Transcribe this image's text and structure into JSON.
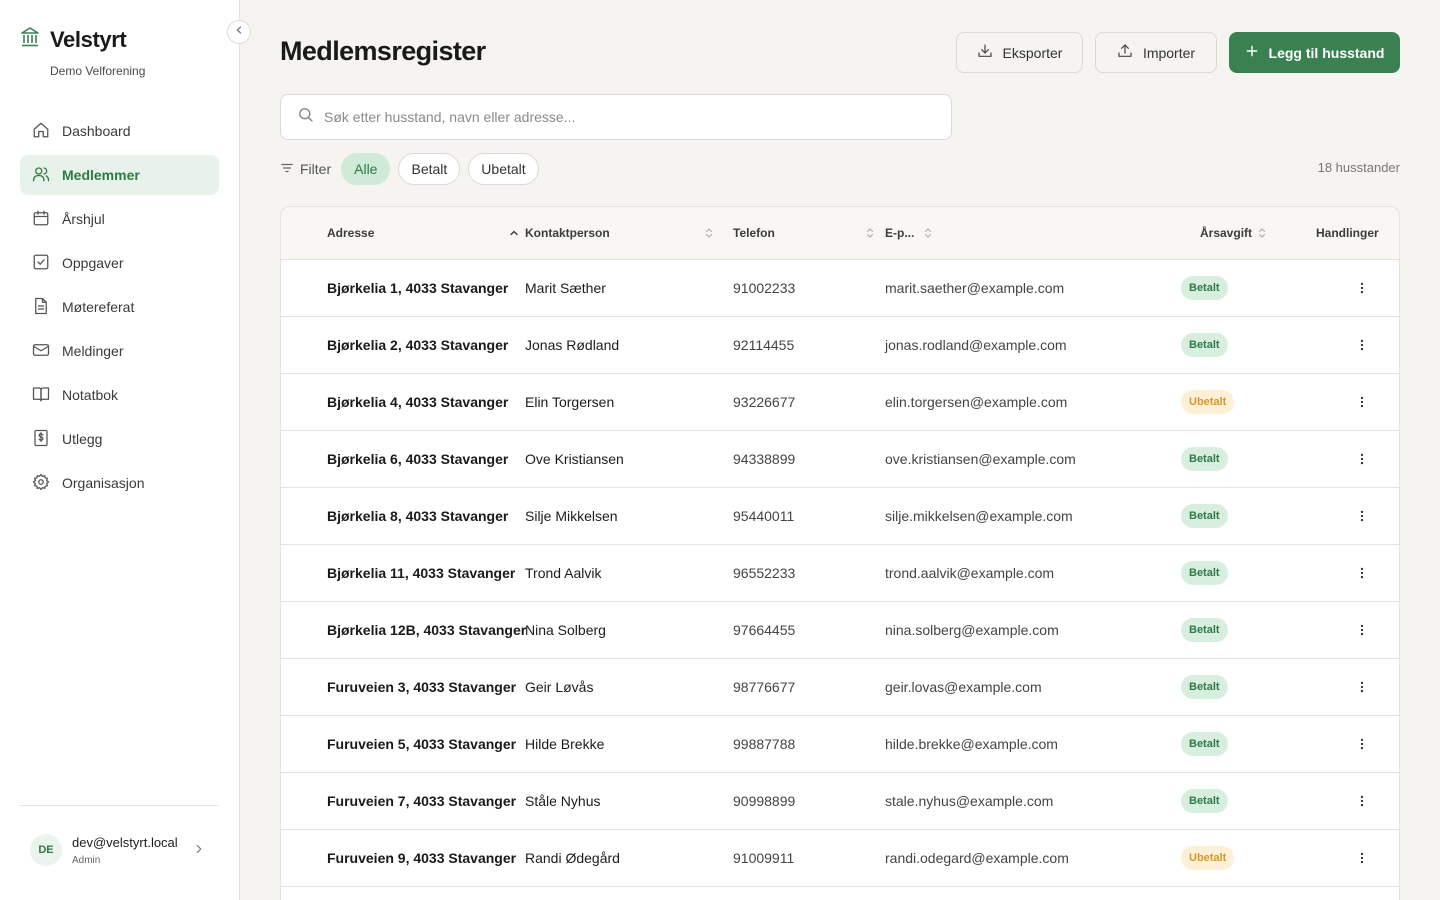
{
  "brand": {
    "name": "Velstyrt",
    "org": "Demo Velforening"
  },
  "nav": [
    {
      "label": "Dashboard",
      "icon": "home-icon",
      "active": false
    },
    {
      "label": "Medlemmer",
      "icon": "users-icon",
      "active": true
    },
    {
      "label": "Årshjul",
      "icon": "calendar-icon",
      "active": false
    },
    {
      "label": "Oppgaver",
      "icon": "checkbox-icon",
      "active": false
    },
    {
      "label": "Møtereferat",
      "icon": "document-icon",
      "active": false
    },
    {
      "label": "Meldinger",
      "icon": "mail-icon",
      "active": false
    },
    {
      "label": "Notatbok",
      "icon": "book-icon",
      "active": false
    },
    {
      "label": "Utlegg",
      "icon": "receipt-icon",
      "active": false
    },
    {
      "label": "Organisasjon",
      "icon": "gear-icon",
      "active": false
    }
  ],
  "user": {
    "initials": "DE",
    "email": "dev@velstyrt.local",
    "role": "Admin"
  },
  "page": {
    "title": "Medlemsregister"
  },
  "toolbar": {
    "export_label": "Eksporter",
    "import_label": "Importer",
    "add_label": "Legg til husstand"
  },
  "search": {
    "placeholder": "Søk etter husstand, navn eller adresse..."
  },
  "filter": {
    "label": "Filter",
    "chips": [
      "Alle",
      "Betalt",
      "Ubetalt"
    ],
    "active": "Alle"
  },
  "count_text": "18 husstander",
  "table": {
    "headers": {
      "address": "Adresse",
      "contact": "Kontaktperson",
      "phone": "Telefon",
      "email": "E-p...",
      "fee": "Årsavgift",
      "actions": "Handlinger"
    },
    "rows": [
      {
        "address": "Bjørkelia 1, 4033 Stavanger",
        "contact": "Marit Sæther",
        "phone": "91002233",
        "email": "marit.saether@example.com",
        "status": "Betalt"
      },
      {
        "address": "Bjørkelia 2, 4033 Stavanger",
        "contact": "Jonas Rødland",
        "phone": "92114455",
        "email": "jonas.rodland@example.com",
        "status": "Betalt"
      },
      {
        "address": "Bjørkelia 4, 4033 Stavanger",
        "contact": "Elin Torgersen",
        "phone": "93226677",
        "email": "elin.torgersen@example.com",
        "status": "Ubetalt"
      },
      {
        "address": "Bjørkelia 6, 4033 Stavanger",
        "contact": "Ove Kristiansen",
        "phone": "94338899",
        "email": "ove.kristiansen@example.com",
        "status": "Betalt"
      },
      {
        "address": "Bjørkelia 8, 4033 Stavanger",
        "contact": "Silje Mikkelsen",
        "phone": "95440011",
        "email": "silje.mikkelsen@example.com",
        "status": "Betalt"
      },
      {
        "address": "Bjørkelia 11, 4033 Stavanger",
        "contact": "Trond Aalvik",
        "phone": "96552233",
        "email": "trond.aalvik@example.com",
        "status": "Betalt"
      },
      {
        "address": "Bjørkelia 12B, 4033 Stavanger",
        "contact": "Nina Solberg",
        "phone": "97664455",
        "email": "nina.solberg@example.com",
        "status": "Betalt"
      },
      {
        "address": "Furuveien 3, 4033 Stavanger",
        "contact": "Geir Løvås",
        "phone": "98776677",
        "email": "geir.lovas@example.com",
        "status": "Betalt"
      },
      {
        "address": "Furuveien 5, 4033 Stavanger",
        "contact": "Hilde Brekke",
        "phone": "99887788",
        "email": "hilde.brekke@example.com",
        "status": "Betalt"
      },
      {
        "address": "Furuveien 7, 4033 Stavanger",
        "contact": "Ståle Nyhus",
        "phone": "90998899",
        "email": "stale.nyhus@example.com",
        "status": "Betalt"
      },
      {
        "address": "Furuveien 9, 4033 Stavanger",
        "contact": "Randi Ødegård",
        "phone": "91009911",
        "email": "randi.odegard@example.com",
        "status": "Ubetalt"
      }
    ]
  },
  "colors": {
    "accent": "#3a8152",
    "paid_bg": "#d8efdf",
    "unpaid_bg": "#fdf0d6",
    "unpaid_text": "#d39a2a"
  }
}
